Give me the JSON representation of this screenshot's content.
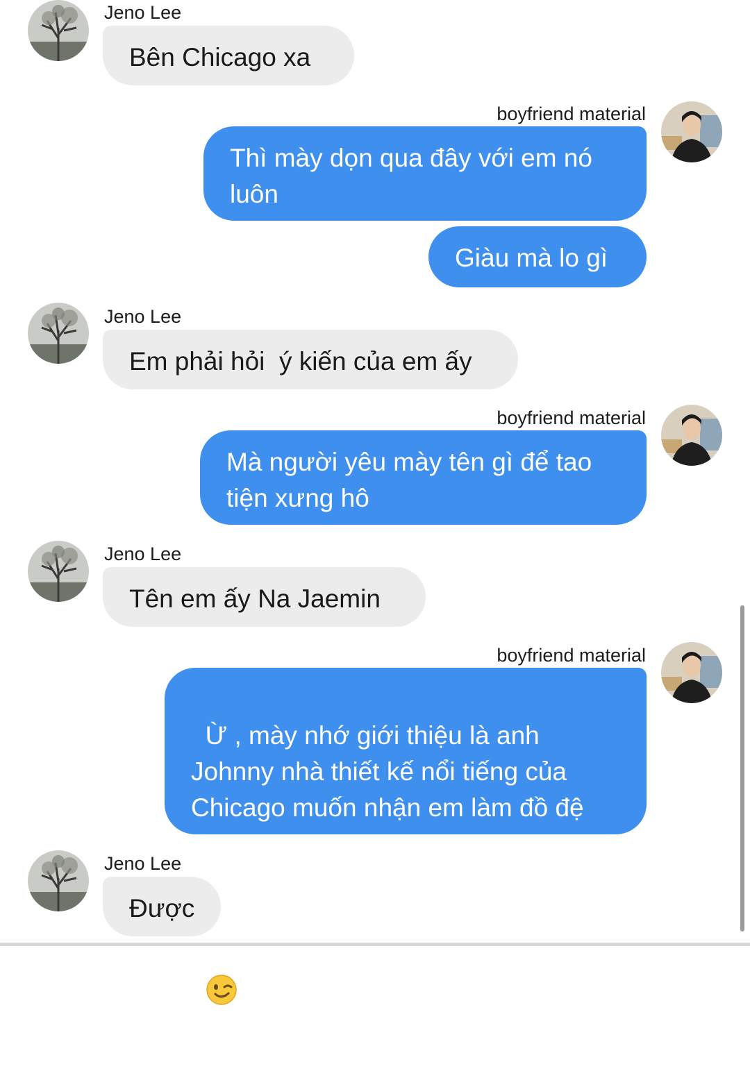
{
  "contacts": {
    "other": {
      "name": "Jeno Lee",
      "avatar_icon": "tree-photo-avatar"
    },
    "me": {
      "name": "boyfriend material",
      "avatar_icon": "man-photo-avatar"
    }
  },
  "messages": [
    {
      "from": "Jeno Lee",
      "text": "Bên Chicago xa"
    },
    {
      "from": "boyfriend material",
      "text": "Thì mày dọn qua đây với em nó luôn"
    },
    {
      "from": "boyfriend material",
      "text": "Giàu mà lo gì"
    },
    {
      "from": "Jeno Lee",
      "text": "Em phải hỏi  ý kiến của em ấy"
    },
    {
      "from": "boyfriend material",
      "text": "Mà người yêu mày tên gì để tao tiện xưng hô"
    },
    {
      "from": "Jeno Lee",
      "text": "Tên em ấy Na Jaemin"
    },
    {
      "from": "boyfriend material",
      "text": "Ừ , mày nhớ giới thiệu là anh Johnny nhà thiết kế nổi tiếng của Chicago muốn nhận em làm đồ đệ",
      "emoji": "winking-face-icon"
    },
    {
      "from": "Jeno Lee",
      "text": "Được"
    }
  ],
  "colors": {
    "outgoing_bubble": "#3e8fee",
    "incoming_bubble": "#ececec",
    "background": "#ffffff"
  }
}
